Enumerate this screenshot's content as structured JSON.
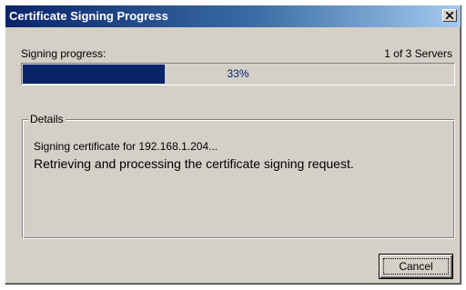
{
  "window": {
    "title": "Certificate Signing Progress",
    "close_glyph": "close-icon"
  },
  "progress": {
    "label": "Signing progress:",
    "count_text": "1 of 3 Servers",
    "percent_text": "33%",
    "fraction": 0.33,
    "fill_color": "#0a246a"
  },
  "details": {
    "legend": "Details",
    "line1": "Signing certificate for 192.168.1.204...",
    "line2": "Retrieving and processing the certificate signing request."
  },
  "buttons": {
    "cancel_label": "Cancel"
  },
  "colors": {
    "face": "#d4d0c8",
    "title_start": "#0a246a",
    "title_end": "#a6caf0"
  }
}
